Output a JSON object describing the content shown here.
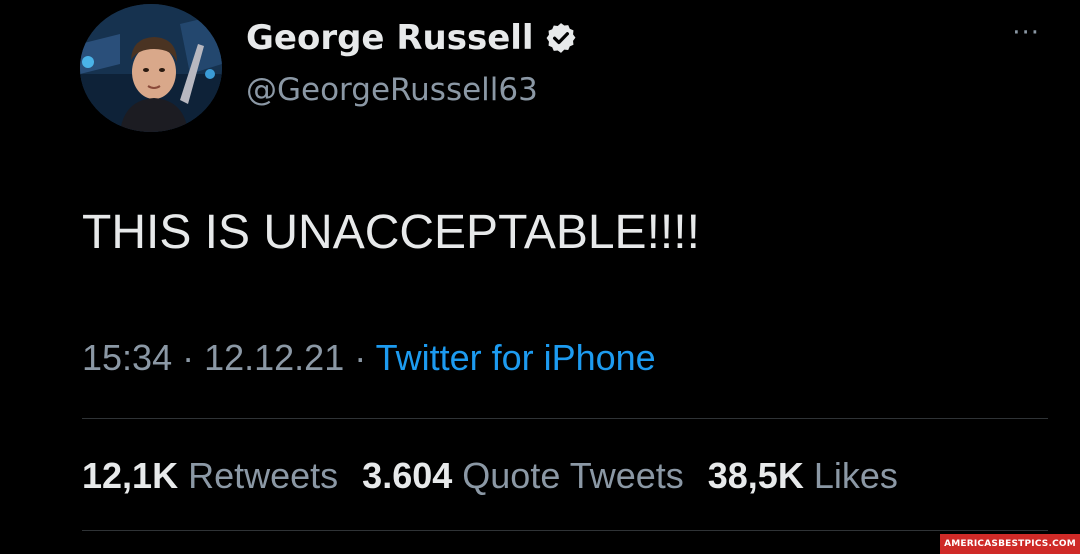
{
  "author": {
    "display_name": "George Russell",
    "handle": "@GeorgeRussell63",
    "verified_icon": "verified-badge-icon",
    "avatar_icon": "profile-avatar"
  },
  "more_label": "···",
  "tweet": {
    "text": "THIS IS UNACCEPTABLE!!!!"
  },
  "meta": {
    "time": "15:34",
    "sep1": " · ",
    "date": "12.12.21",
    "sep2": " · ",
    "source": "Twitter for iPhone"
  },
  "stats": {
    "retweets_count": "12,1K",
    "retweets_label": "Retweets",
    "quotes_count": "3.604",
    "quotes_label": "Quote Tweets",
    "likes_count": "38,5K",
    "likes_label": "Likes"
  },
  "watermark": "AMERICASBESTPICS.COM",
  "colors": {
    "background": "#000000",
    "primary_text": "#e7e9ea",
    "secondary_text": "#8b98a5",
    "link": "#1d9bf0",
    "divider": "#2f3336",
    "watermark_bg": "#cf2a27"
  }
}
